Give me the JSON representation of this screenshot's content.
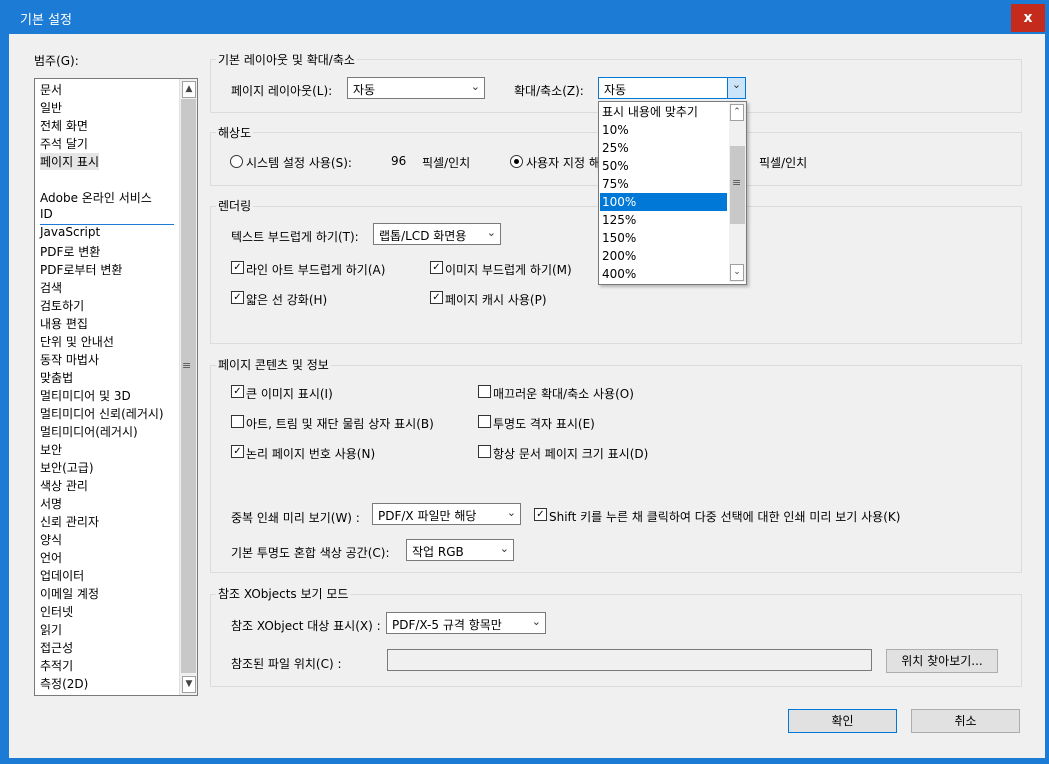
{
  "window": {
    "title": "기본 설정",
    "close": "x"
  },
  "category": {
    "label": "범주(G):",
    "items_top": [
      "문서",
      "일반",
      "전체 화면",
      "주석 달기",
      "페이지 표시"
    ],
    "items_bottom": [
      "Adobe 온라인 서비스",
      "ID",
      "JavaScript",
      "PDF로 변환",
      "PDF로부터 변환",
      "검색",
      "검토하기",
      "내용 편집",
      "단위 및 안내선",
      "동작 마법사",
      "맞춤법",
      "멀티미디어 및 3D",
      "멀티미디어 신뢰(레거시)",
      "멀티미디어(레거시)",
      "보안",
      "보안(고급)",
      "색상 관리",
      "서명",
      "신뢰 관리자",
      "양식",
      "언어",
      "업데이터",
      "이메일 계정",
      "인터넷",
      "읽기",
      "접근성",
      "추적기",
      "측정(2D)"
    ]
  },
  "layout": {
    "group_title": "기본 레이아웃 및 확대/축소",
    "page_layout_label": "페이지 레이아웃(L):",
    "page_layout_value": "자동",
    "zoom_label": "확대/축소(Z):",
    "zoom_value": "자동",
    "zoom_options": [
      "표시 내용에 맞추기",
      "10%",
      "25%",
      "50%",
      "75%",
      "100%",
      "125%",
      "150%",
      "200%",
      "400%"
    ],
    "zoom_highlight": "100%"
  },
  "resolution": {
    "group_title": "해상도",
    "system_label": "시스템 설정 사용(S):",
    "system_value": "96",
    "system_unit": "픽셀/인치",
    "custom_label": "사용자 지정 해",
    "custom_unit": "픽셀/인치"
  },
  "rendering": {
    "group_title": "렌더링",
    "smooth_text_label": "텍스트 부드럽게 하기(T):",
    "smooth_text_value": "랩톱/LCD 화면용",
    "smooth_line_art": "라인 아트 부드럽게 하기(A)",
    "smooth_images": "이미지 부드럽게 하기(M)",
    "enhance_thin": "얇은 선 강화(H)",
    "page_cache": "페이지 캐시 사용(P)"
  },
  "content": {
    "group_title": "페이지 콘텐츠 및 정보",
    "large_images": "큰 이미지 표시(I)",
    "smooth_zoom": "매끄러운 확대/축소 사용(O)",
    "art_trim": "아트, 트림 및 재단 물림 상자 표시(B)",
    "transparency_grid": "투명도 격자 표시(E)",
    "logical_page": "논리 페이지 번호 사용(N)",
    "always_doc_size": "항상 문서 페이지 크기 표시(D)",
    "overprint_label": "중복 인쇄 미리 보기(W) :",
    "overprint_value": "PDF/X 파일만 해당",
    "shift_click": "Shift 키를 누른 채 클릭하여 다중 선택에 대한 인쇄 미리 보기 사용(K)",
    "blend_label": "기본 투명도 혼합 색상 공간(C):",
    "blend_value": "작업 RGB"
  },
  "xobjects": {
    "group_title": "참조 XObjects 보기 모드",
    "show_label": "참조 XObject 대상 표시(X) :",
    "show_value": "PDF/X-5 규격 항목만",
    "location_label": "참조된 파일 위치(C) :",
    "location_value": "",
    "browse": "위치 찾아보기..."
  },
  "buttons": {
    "ok": "확인",
    "cancel": "취소"
  },
  "colors": {
    "titlebar": "#1c7bd4",
    "close": "#c42b1c",
    "highlight": "#0078d7"
  }
}
